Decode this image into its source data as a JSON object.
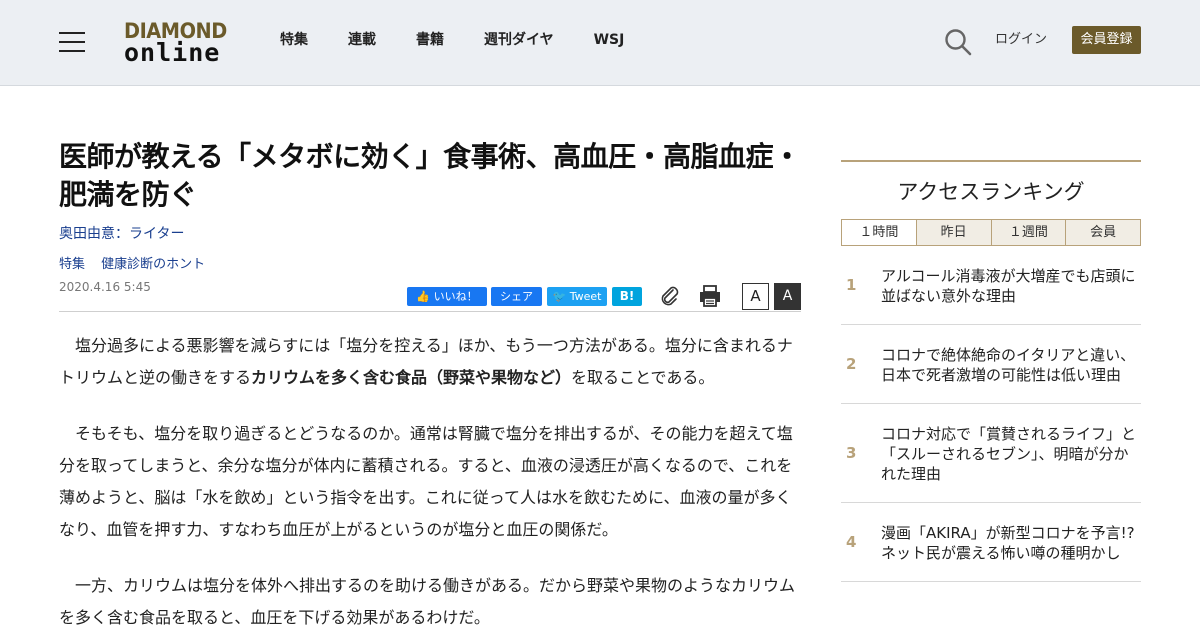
{
  "header": {
    "logo_top": "DIAMOND",
    "logo_bottom": "online",
    "nav": [
      "特集",
      "連載",
      "書籍",
      "週刊ダイヤ",
      "WSJ"
    ],
    "login": "ログイン",
    "register": "会員登録",
    "brand_color": "#6b5a2a"
  },
  "article": {
    "title": "医師が教える「メタボに効く」食事術、高血圧・高脂血症・肥満を防ぐ",
    "author": "奥田由意：ライター",
    "categories": [
      "特集",
      "健康診断のホント"
    ],
    "date": "2020.4.16 5:45",
    "share": {
      "like": "いいね！",
      "fbshare": "シェア",
      "tweet": "Tweet",
      "hatena": "B!"
    },
    "font_small": "A",
    "font_large": "A",
    "p1_a": "塩分過多による悪影響を減らすには「塩分を控える」ほか、もう一つ方法がある。塩分に含まれるナトリウムと逆の働きをする",
    "p1_bold": "カリウムを多く含む食品（野菜や果物など）",
    "p1_b": "を取ることである。",
    "p2": "そもそも、塩分を取り過ぎるとどうなるのか。通常は腎臓で塩分を排出するが、その能力を超えて塩分を取ってしまうと、余分な塩分が体内に蓄積される。すると、血液の浸透圧が高くなるので、これを薄めようと、脳は「水を飲め」という指令を出す。これに従って人は水を飲むために、血液の量が多くなり、血管を押す力、すなわち血圧が上がるというのが塩分と血圧の関係だ。",
    "p3": "一方、カリウムは塩分を体外へ排出するのを助ける働きがある。だから野菜や果物のようなカリウムを多く含む食品を取ると、血圧を下げる効果があるわけだ。"
  },
  "sidebar": {
    "title": "アクセスランキング",
    "tabs": [
      "１時間",
      "昨日",
      "１週間",
      "会員"
    ],
    "ranking": [
      {
        "num": "1",
        "text": "アルコール消毒液が大増産でも店頭に並ばない意外な理由"
      },
      {
        "num": "2",
        "text": "コロナで絶体絶命のイタリアと違い、日本で死者激増の可能性は低い理由"
      },
      {
        "num": "3",
        "text": "コロナ対応で「賞賛されるライフ」と「スルーされるセブン」、明暗が分かれた理由"
      },
      {
        "num": "4",
        "text": "漫画「AKIRA」が新型コロナを予言!?ネット民が震える怖い噂の種明かし"
      }
    ]
  }
}
